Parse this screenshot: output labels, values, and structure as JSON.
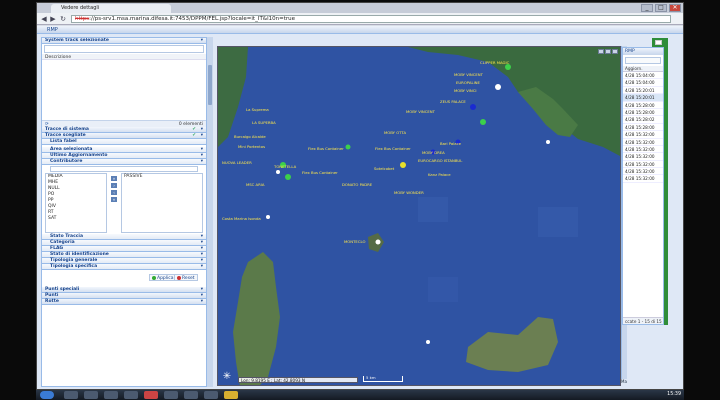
{
  "browser": {
    "tab_title": "Vedere dettagli",
    "url_scheme": "https",
    "url_rest": "://ps-srv1.msa.marina.difesa.it:7453/DPPM/FEL.jsp?locale=it_IT&l10n=true",
    "controls": [
      "_",
      "□",
      "✕"
    ],
    "nav": [
      "◀",
      "▶",
      "↻"
    ]
  },
  "app": {
    "header": "RMP"
  },
  "left_panel": {
    "system_tracks": "System track selezionate",
    "description": "Descrizione",
    "count": "0 elementi",
    "refresh": "⟳",
    "system_tracks_group": "Tracce di sistema",
    "selected_tracks": "Tracce scegliate",
    "list_label": "Lista fabel",
    "selected_area": "Area selezionata",
    "last_update": "Ultimo Aggiornamento",
    "contributors": "Contributore",
    "contributor_list": [
      "MEDIA",
      "MHE",
      "NULL",
      "PO",
      "PP",
      "QIV",
      "RT",
      "SAT"
    ],
    "passive_label": "PASSIVE",
    "arrows": [
      "»",
      "›",
      "‹",
      "«"
    ],
    "filters": [
      "Stato Traccia",
      "Categoria",
      "FLAG",
      "Stato di identificazione",
      "Tipologia generale",
      "Tipologia specifica"
    ],
    "apply": "Applica",
    "reset": "Reset",
    "bottom_groups": [
      "Punti speciali",
      "Punti",
      "Rotte"
    ],
    "toggle": "▾",
    "check": "✔"
  },
  "map": {
    "labels": [
      {
        "text": "CLIPPER MAGIC"
      },
      {
        "text": "MOBY VINCENT"
      },
      {
        "text": "EUROPALINE"
      },
      {
        "text": "MOBY VINCI"
      },
      {
        "text": "ZEUS PALACE"
      },
      {
        "text": "MOBY VINCENT"
      },
      {
        "text": "MOBY OTTA"
      },
      {
        "text": "MOBY DREA"
      },
      {
        "text": "EUROCARGO ISTANBUL"
      },
      {
        "text": "Bari Palace"
      },
      {
        "text": "Kanz Palace"
      },
      {
        "text": "MOBY WONDER"
      },
      {
        "text": "Flex Bus Container"
      },
      {
        "text": "Flex Bus Container"
      },
      {
        "text": "Sotelcobet"
      },
      {
        "text": "DONATO PADRE"
      },
      {
        "text": "La Suprema"
      },
      {
        "text": "LA SUPERBA"
      },
      {
        "text": "Burcalgo Alcalde"
      },
      {
        "text": "Mini Portentos"
      },
      {
        "text": "NUOVA LEADER"
      },
      {
        "text": "TONETELLA"
      },
      {
        "text": "Flex Bus Container"
      },
      {
        "text": "MSC ARIA"
      },
      {
        "text": "Costa Marina Isonda"
      },
      {
        "text": "MONTECLO"
      }
    ],
    "coords": "Lon: 9.8195 E ; Lat: 42.8093 N",
    "scale": "5 km",
    "compass": "✳",
    "corner": "Ma"
  },
  "right_window": {
    "title": "RMP",
    "column": "Aggiorn.",
    "timestamps": [
      "4/28 15:04:00",
      "4/28 15:04:00",
      "4/28 15:20:01",
      "4/28 15:20:01",
      "4/28 15:28:00",
      "4/28 15:28:00",
      "4/28 15:28:02",
      "4/28 15:28:00",
      "4/28 15:32:00",
      "4/28 15:32:00",
      "4/28 15:32:00",
      "4/28 15:32:00",
      "4/28 15:32:00",
      "4/28 15:32:00",
      "4/28 15:32:00"
    ],
    "footer": "ccate 1 - 15 di 15"
  },
  "taskbar": {
    "clock": "15:39"
  }
}
